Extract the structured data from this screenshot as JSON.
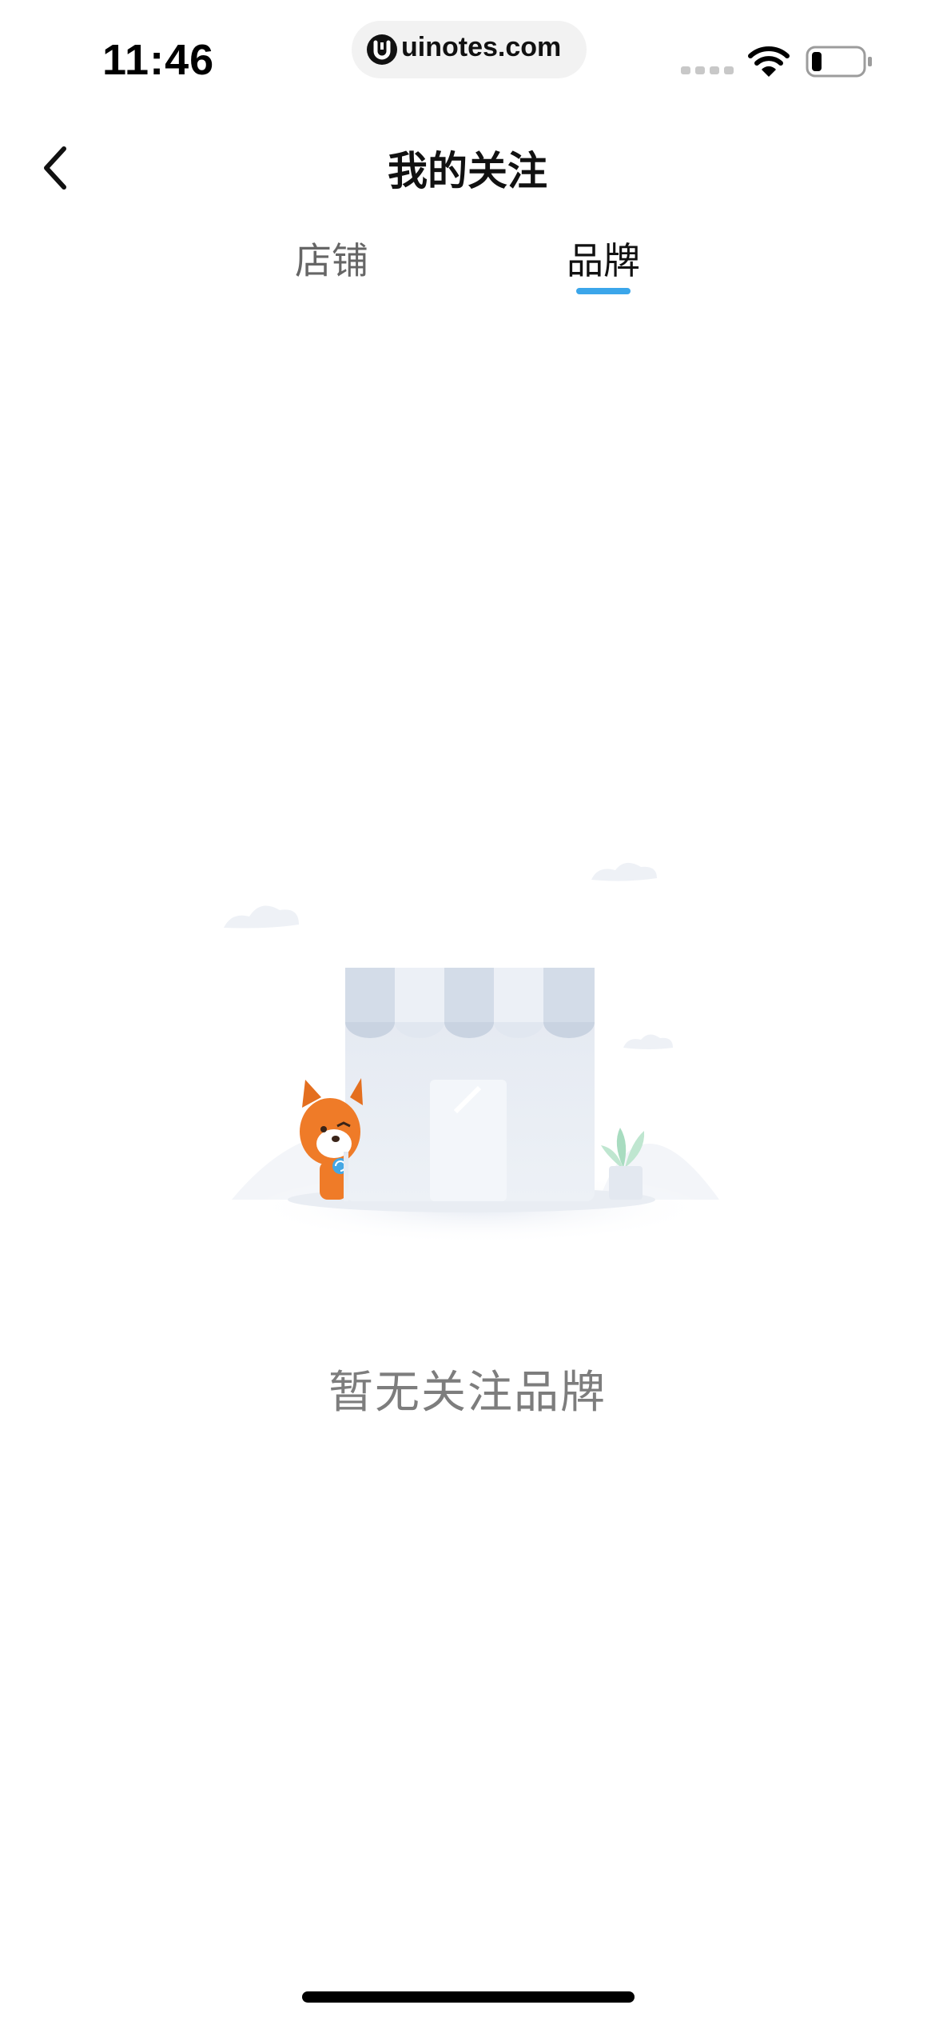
{
  "status_bar": {
    "time": "11:46",
    "url": "uinotes.com",
    "icons": [
      "signal-icon",
      "wifi-icon",
      "battery-icon"
    ]
  },
  "nav": {
    "back_icon": "chevron-left-icon",
    "title": "我的关注"
  },
  "tabs": {
    "items": [
      {
        "label": "店铺",
        "active": false
      },
      {
        "label": "品牌",
        "active": true
      }
    ],
    "active_color": "#3ba6ea"
  },
  "empty_state": {
    "illustration": "shop-with-dog-illustration",
    "message": "暂无关注品牌"
  },
  "colors": {
    "accent": "#3ba6ea",
    "text_primary": "#111111",
    "text_secondary": "#666666",
    "text_muted": "#7d7d7d"
  }
}
